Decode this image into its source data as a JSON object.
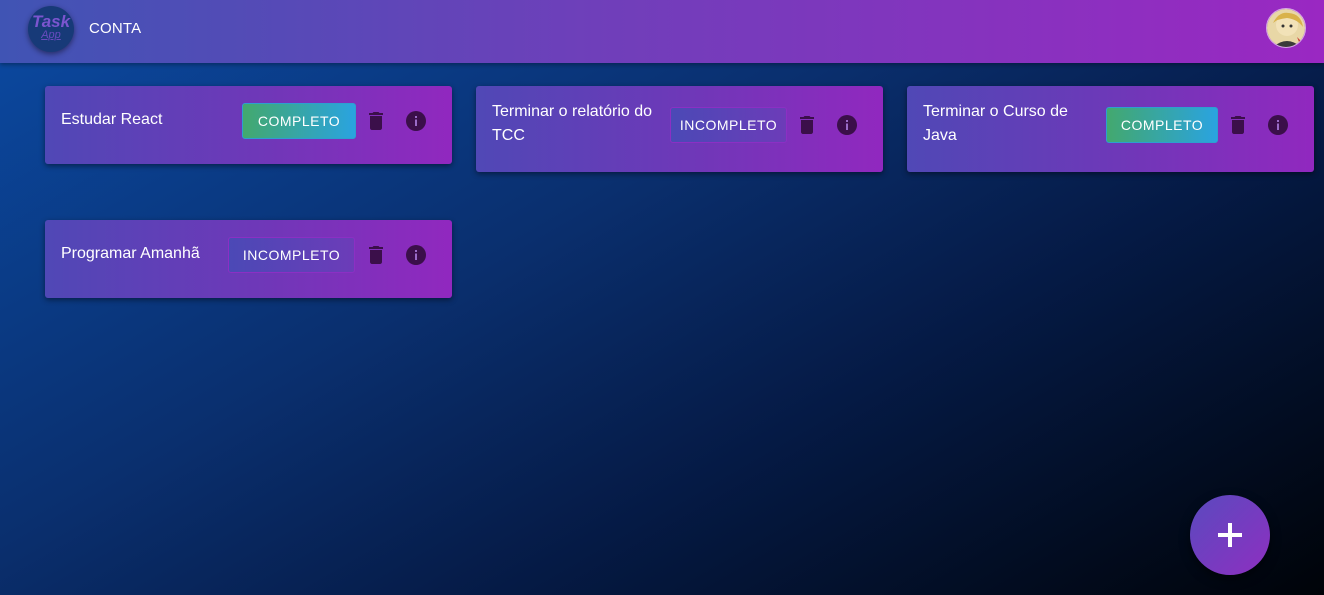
{
  "header": {
    "logo_line1": "Task",
    "logo_line2": "App",
    "nav_label": "CONTA"
  },
  "tasks": [
    {
      "title": "Estudar React",
      "status": "COMPLETO"
    },
    {
      "title": "Terminar o relatório do TCC",
      "status": "INCOMPLETO"
    },
    {
      "title": "Terminar o Curso de Java",
      "status": "COMPLETO"
    },
    {
      "title": "Programar Amanhã",
      "status": "INCOMPLETO"
    }
  ],
  "icons": {
    "delete": "trash-icon",
    "info": "info-icon",
    "add": "plus-icon"
  },
  "colors": {
    "complete_button": "#2aa3e0",
    "incomplete_button": "#6c3cb8",
    "icon_dark": "#3b0f4a"
  }
}
